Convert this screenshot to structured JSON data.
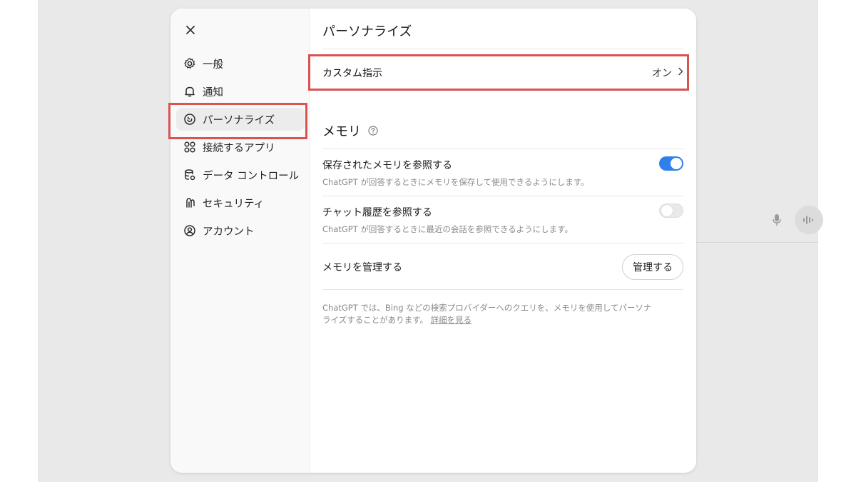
{
  "sidebar": {
    "items": [
      {
        "label": "一般",
        "icon": "gear-icon"
      },
      {
        "label": "通知",
        "icon": "bell-icon"
      },
      {
        "label": "パーソナライズ",
        "icon": "personalize-icon",
        "active": true
      },
      {
        "label": "接続するアプリ",
        "icon": "apps-icon"
      },
      {
        "label": "データ コントロール",
        "icon": "database-icon"
      },
      {
        "label": "セキュリティ",
        "icon": "security-icon"
      },
      {
        "label": "アカウント",
        "icon": "account-icon"
      }
    ]
  },
  "main": {
    "title": "パーソナライズ",
    "custom_instructions": {
      "label": "カスタム指示",
      "value": "オン"
    },
    "memory": {
      "title": "メモリ",
      "saved_memory": {
        "label": "保存されたメモリを参照する",
        "description": "ChatGPT が回答するときにメモリを保存して使用できるようにします。",
        "enabled": true
      },
      "chat_history": {
        "label": "チャット履歴を参照する",
        "description": "ChatGPT が回答するときに最近の会話を参照できるようにします。",
        "enabled": false
      },
      "manage": {
        "label": "メモリを管理する",
        "button": "管理する"
      },
      "footer_text": "ChatGPT では、Bing などの検索プロバイダーへのクエリを、メモリを使用してパーソナライズすることがあります。",
      "footer_link": "詳細を見る"
    }
  },
  "colors": {
    "toggle_on": "#2f80ed",
    "highlight": "#d9534f",
    "sidebar_bg": "#f9f9f9",
    "active_item_bg": "#ececec"
  }
}
